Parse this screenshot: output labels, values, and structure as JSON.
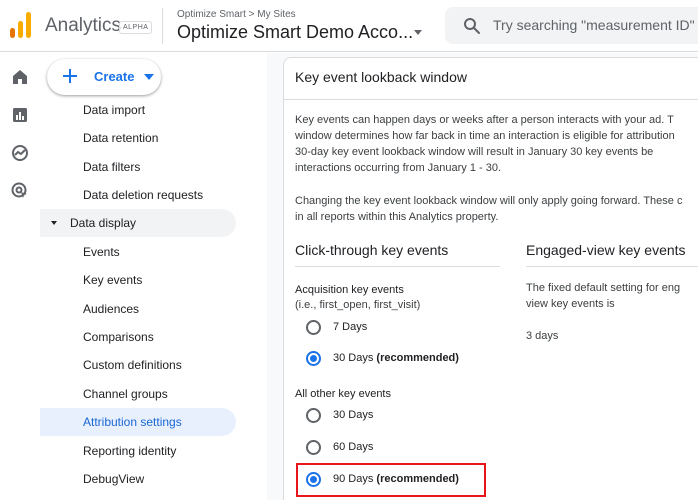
{
  "header": {
    "app_title": "Analytics",
    "badge": "ALPHA",
    "breadcrumb": "Optimize Smart > My Sites",
    "account": "Optimize Smart Demo Acco...",
    "search_placeholder": "Try searching \"measurement ID\""
  },
  "rail": {
    "icons": [
      "home-icon",
      "reports-icon",
      "explore-icon",
      "advertising-icon"
    ]
  },
  "sidebar": {
    "create_label": "Create",
    "items": [
      {
        "label": "Data import"
      },
      {
        "label": "Data retention"
      },
      {
        "label": "Data filters"
      },
      {
        "label": "Data deletion requests"
      },
      {
        "label": "Data display"
      },
      {
        "label": "Events"
      },
      {
        "label": "Key events"
      },
      {
        "label": "Audiences"
      },
      {
        "label": "Comparisons"
      },
      {
        "label": "Custom definitions"
      },
      {
        "label": "Channel groups"
      },
      {
        "label": "Attribution settings"
      },
      {
        "label": "Reporting identity"
      },
      {
        "label": "DebugView"
      }
    ],
    "active_item": "Attribution settings"
  },
  "panel": {
    "title": "Key event lookback window",
    "intro_lines": [
      "Key events can happen days or weeks after a person interacts with your ad. T",
      "window determines how far back in time an interaction is eligible for attribution",
      "30-day key event lookback window will result in January 30 key events be",
      "interactions occurring from January 1 - 30."
    ],
    "change_lines": [
      "Changing the key event lookback window will only apply going forward. These c",
      "in all reports within this Analytics property."
    ],
    "click_through": {
      "title": "Click-through key events",
      "acquisition_label": "Acquisition key events",
      "acquisition_sub": "(i.e., first_open, first_visit)",
      "acquisition_options": [
        {
          "days": "7 Days",
          "note": "",
          "selected": false
        },
        {
          "days": "30 Days",
          "note": "(recommended)",
          "selected": true
        }
      ],
      "other_label": "All other key events",
      "other_options": [
        {
          "days": "30 Days",
          "note": "",
          "selected": false
        },
        {
          "days": "60 Days",
          "note": "",
          "selected": false
        },
        {
          "days": "90 Days",
          "note": "(recommended)",
          "selected": true
        }
      ]
    },
    "engaged_view": {
      "title": "Engaged-view key events",
      "desc_lines": [
        "The fixed default setting for eng",
        "view key events is"
      ],
      "value": "3 days"
    }
  },
  "colors": {
    "accent": "#1a73e8",
    "active_nav_bg": "#e8f0fe",
    "highlight_border": "#e8161b",
    "logo_orange": "#f9ab00",
    "logo_dark": "#e37400"
  }
}
